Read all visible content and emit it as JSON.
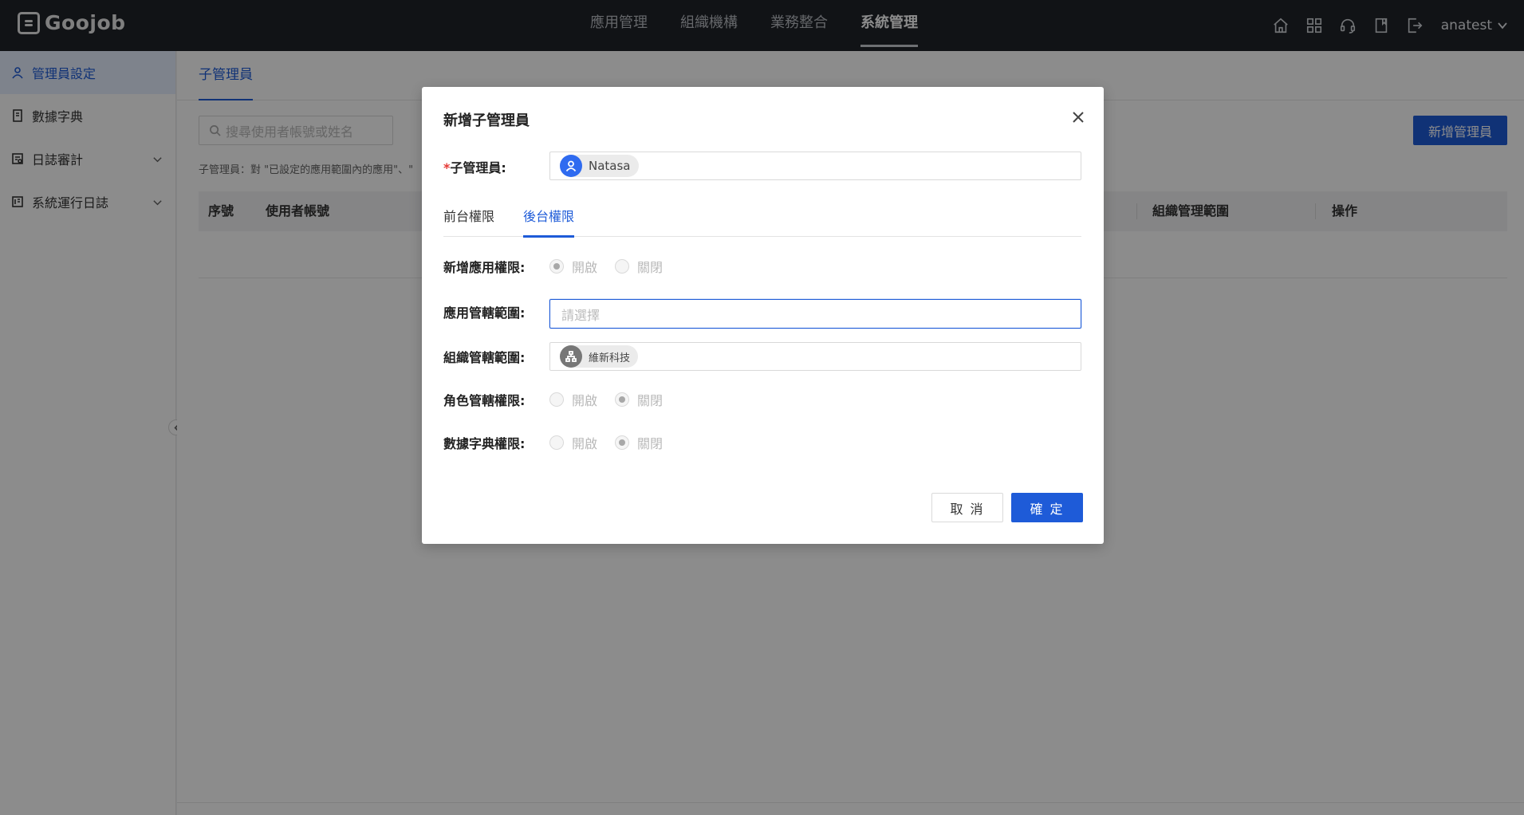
{
  "header": {
    "logo_text": "Goojob",
    "nav": [
      {
        "label": "應用管理",
        "active": false
      },
      {
        "label": "組織機構",
        "active": false
      },
      {
        "label": "業務整合",
        "active": false
      },
      {
        "label": "系統管理",
        "active": true
      }
    ],
    "icons": [
      "home-icon",
      "apps-grid-icon",
      "support-headset-icon",
      "book-icon",
      "export-icon"
    ],
    "username": "anatest"
  },
  "sidebar": {
    "items": [
      {
        "label": "管理員設定",
        "icon": "user-icon",
        "active": true,
        "expandable": false
      },
      {
        "label": "數據字典",
        "icon": "dictionary-icon",
        "active": false,
        "expandable": false
      },
      {
        "label": "日誌審計",
        "icon": "audit-icon",
        "active": false,
        "expandable": true
      },
      {
        "label": "系統運行日誌",
        "icon": "log-icon",
        "active": false,
        "expandable": true
      }
    ]
  },
  "main": {
    "tab": "子管理員",
    "search_placeholder": "搜尋使用者帳號或姓名",
    "add_button": "新增管理員",
    "hint": "子管理員：對 \"已設定的應用範圍內的應用\"、\"",
    "columns": [
      "序號",
      "使用者帳號",
      "組織管理範圍",
      "操作"
    ]
  },
  "modal": {
    "title": "新增子管理員",
    "admin_label": "子管理員",
    "admin_required_mark": "*",
    "admin_value": "Natasa",
    "tabs": [
      {
        "label": "前台權限",
        "active": false
      },
      {
        "label": "後台權限",
        "active": true
      }
    ],
    "add_app_label": "新增應用權限:",
    "add_app_selected": "開啟",
    "app_scope_label": "應用管轄範圍:",
    "app_scope_placeholder": "請選擇",
    "org_scope_label": "組織管轄範圍:",
    "org_scope_value": "維新科技",
    "role_label": "角色管轄權限:",
    "role_selected": "關閉",
    "dict_label": "數據字典權限:",
    "dict_selected": "關閉",
    "opt_on": "開啟",
    "opt_off": "關閉",
    "cancel": "取 消",
    "ok": "確 定"
  }
}
